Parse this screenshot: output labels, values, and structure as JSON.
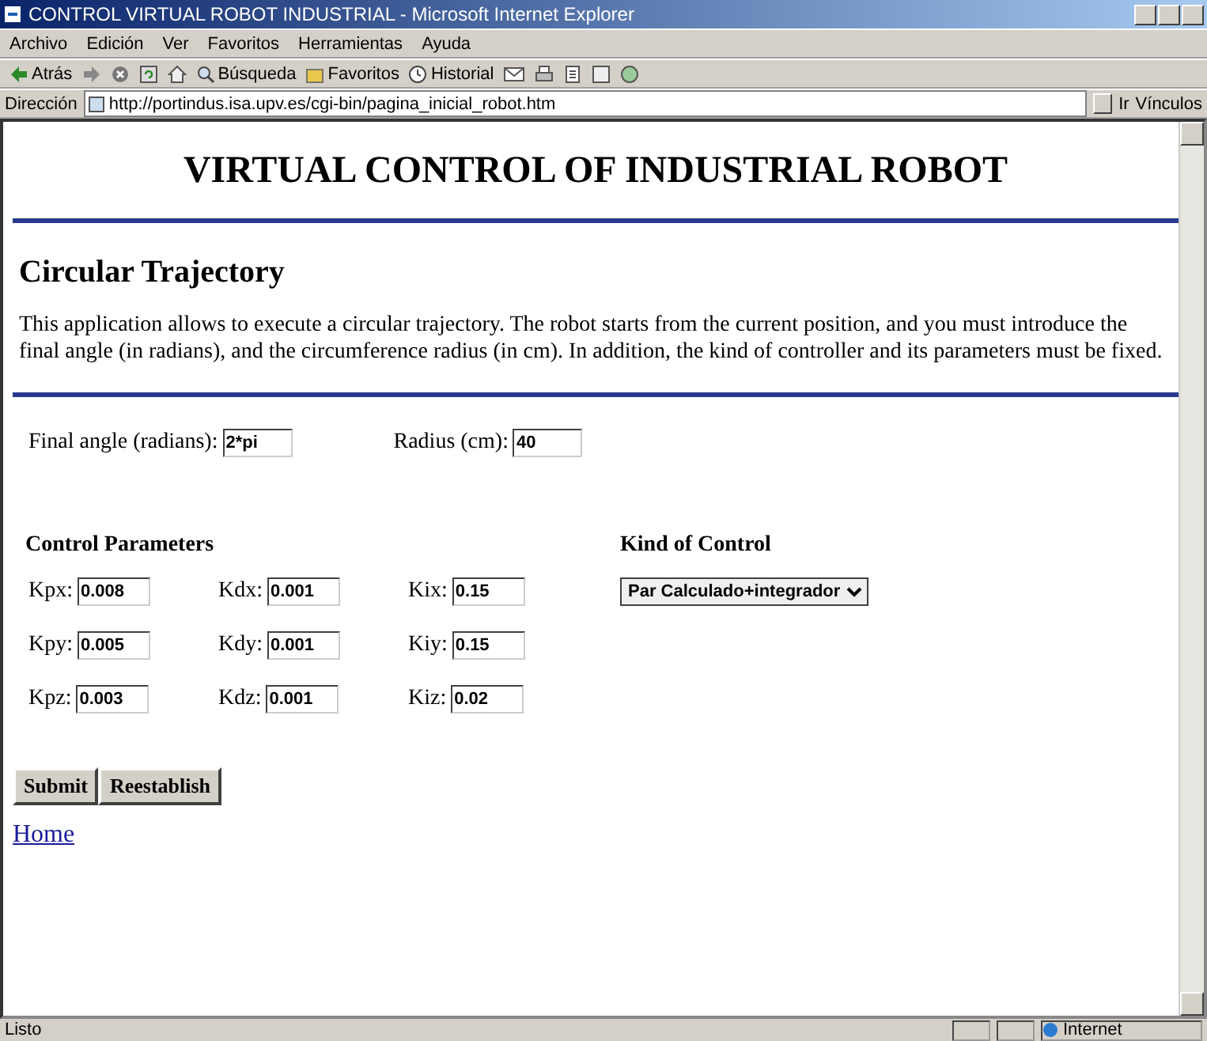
{
  "window": {
    "title": "CONTROL VIRTUAL ROBOT INDUSTRIAL - Microsoft Internet Explorer"
  },
  "menu": [
    "Archivo",
    "Edición",
    "Ver",
    "Favoritos",
    "Herramientas",
    "Ayuda"
  ],
  "toolbar": [
    {
      "kind": "back",
      "label": "Atrás"
    },
    {
      "kind": "forward"
    },
    {
      "kind": "stop"
    },
    {
      "kind": "refresh"
    },
    {
      "kind": "home"
    },
    {
      "kind": "search",
      "label": "Búsqueda"
    },
    {
      "kind": "favorites",
      "label": "Favoritos"
    },
    {
      "kind": "history",
      "label": "Historial"
    },
    {
      "kind": "mail"
    },
    {
      "kind": "print"
    },
    {
      "kind": "edit"
    },
    {
      "kind": "discuss"
    },
    {
      "kind": "messenger"
    }
  ],
  "address_bar": {
    "label": "Dirección",
    "url": "http://portindus.isa.upv.es/cgi-bin/pagina_inicial_robot.htm",
    "go": "Ir",
    "links": "Vínculos"
  },
  "page": {
    "title": "VIRTUAL CONTROL OF INDUSTRIAL ROBOT",
    "heading": "Circular Trajectory",
    "description": "This application allows to execute a circular trajectory. The robot starts from the current position, and you must introduce the final angle (in radians), and the circumference radius (in cm). In addition, the kind of controller and its parameters must be fixed.",
    "fields": [
      {
        "label": "Final angle (radians):",
        "value": "2*pi"
      },
      {
        "label": "Radius (cm):",
        "value": "40"
      }
    ],
    "control_parameters": {
      "heading": "Control Parameters",
      "rows": [
        [
          {
            "label": "Kpx:",
            "value": "0.008"
          },
          {
            "label": "Kdx:",
            "value": "0.001"
          },
          {
            "label": "Kix:",
            "value": "0.15"
          }
        ],
        [
          {
            "label": "Kpy:",
            "value": "0.005"
          },
          {
            "label": "Kdy:",
            "value": "0.001"
          },
          {
            "label": "Kiy:",
            "value": "0.15"
          }
        ],
        [
          {
            "label": "Kpz:",
            "value": "0.003"
          },
          {
            "label": "Kdz:",
            "value": "0.001"
          },
          {
            "label": "Kiz:",
            "value": "0.02"
          }
        ]
      ]
    },
    "kind_of_control": {
      "heading": "Kind of Control",
      "value": "Par Calculado+integrador"
    },
    "buttons": [
      "Submit",
      "Reestablish"
    ],
    "link": "Home"
  },
  "status_bar": {
    "text": "Listo",
    "zone": "Internet"
  }
}
